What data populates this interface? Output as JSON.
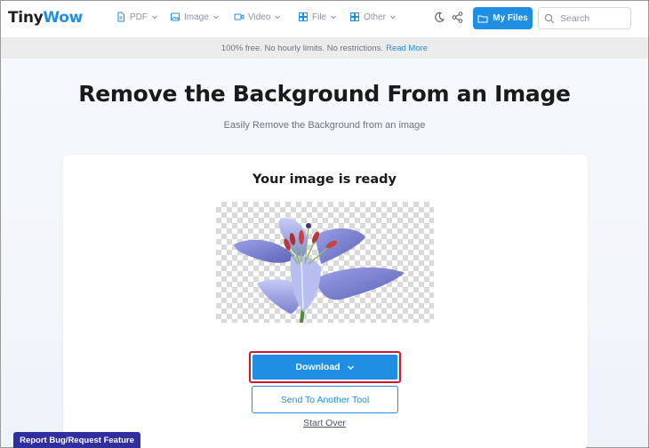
{
  "logo": {
    "part1": "Tiny",
    "part2": "Wow"
  },
  "nav": {
    "items": [
      {
        "label": "PDF",
        "icon": "pdf-icon"
      },
      {
        "label": "Image",
        "icon": "image-icon"
      },
      {
        "label": "Video",
        "icon": "video-icon"
      },
      {
        "label": "File",
        "icon": "file-icon"
      },
      {
        "label": "Other",
        "icon": "grid-icon"
      }
    ],
    "my_files_label": "My Files",
    "search_placeholder": "Search"
  },
  "banner": {
    "text": "100% free. No hourly limits. No restrictions.",
    "link": "Read More"
  },
  "page": {
    "title": "Remove the Background From an Image",
    "subtitle": "Easily Remove the Background from an image"
  },
  "result": {
    "heading": "Your image is ready",
    "download_label": "Download",
    "send_label": "Send To Another Tool",
    "start_over_label": "Start Over"
  },
  "report_label": "Report Bug/Request Feature",
  "colors": {
    "accent": "#1e8fe3",
    "highlight_border": "#d0182a",
    "report_bg": "#2f2f9e"
  }
}
